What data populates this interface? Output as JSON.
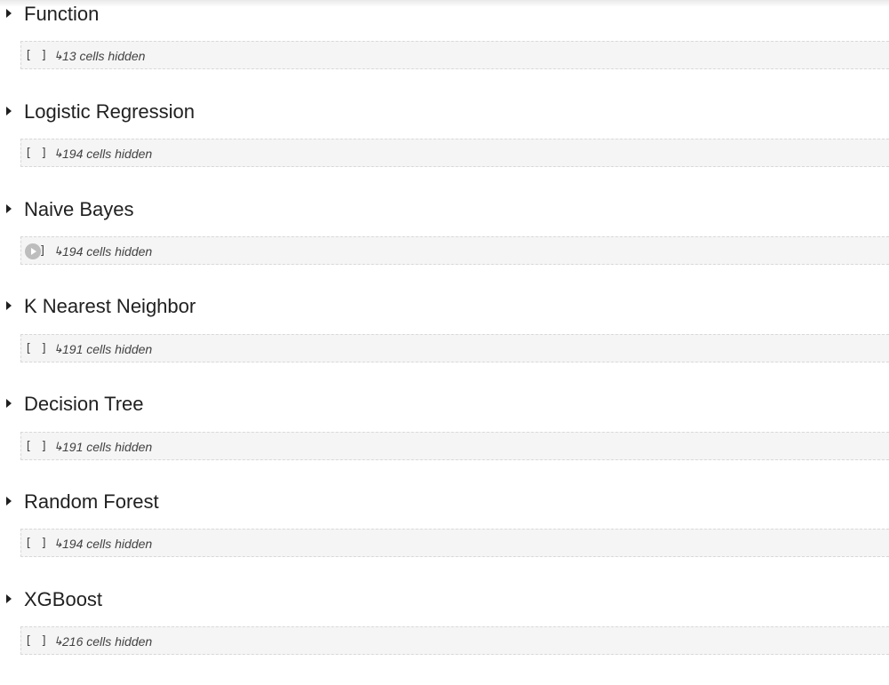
{
  "sections": [
    {
      "title": "Function",
      "hidden": "13 cells hidden"
    },
    {
      "title": "Logistic Regression",
      "hidden": "194 cells hidden"
    },
    {
      "title": "Naive Bayes",
      "hidden": "194 cells hidden"
    },
    {
      "title": "K Nearest Neighbor",
      "hidden": "191 cells hidden"
    },
    {
      "title": "Decision Tree",
      "hidden": "191 cells hidden"
    },
    {
      "title": "Random Forest",
      "hidden": "194 cells hidden"
    },
    {
      "title": "XGBoost",
      "hidden": "216 cells hidden"
    }
  ],
  "run_label": "[ ]",
  "arrow_glyph": "↳",
  "icons": {
    "caret": "section-caret-icon",
    "run": "run-cell-icon",
    "arrow": "hidden-arrow-icon"
  },
  "colors": {
    "cell_bg": "#f5f5f5",
    "cell_border": "#d8d8d8",
    "text": "#212121"
  }
}
